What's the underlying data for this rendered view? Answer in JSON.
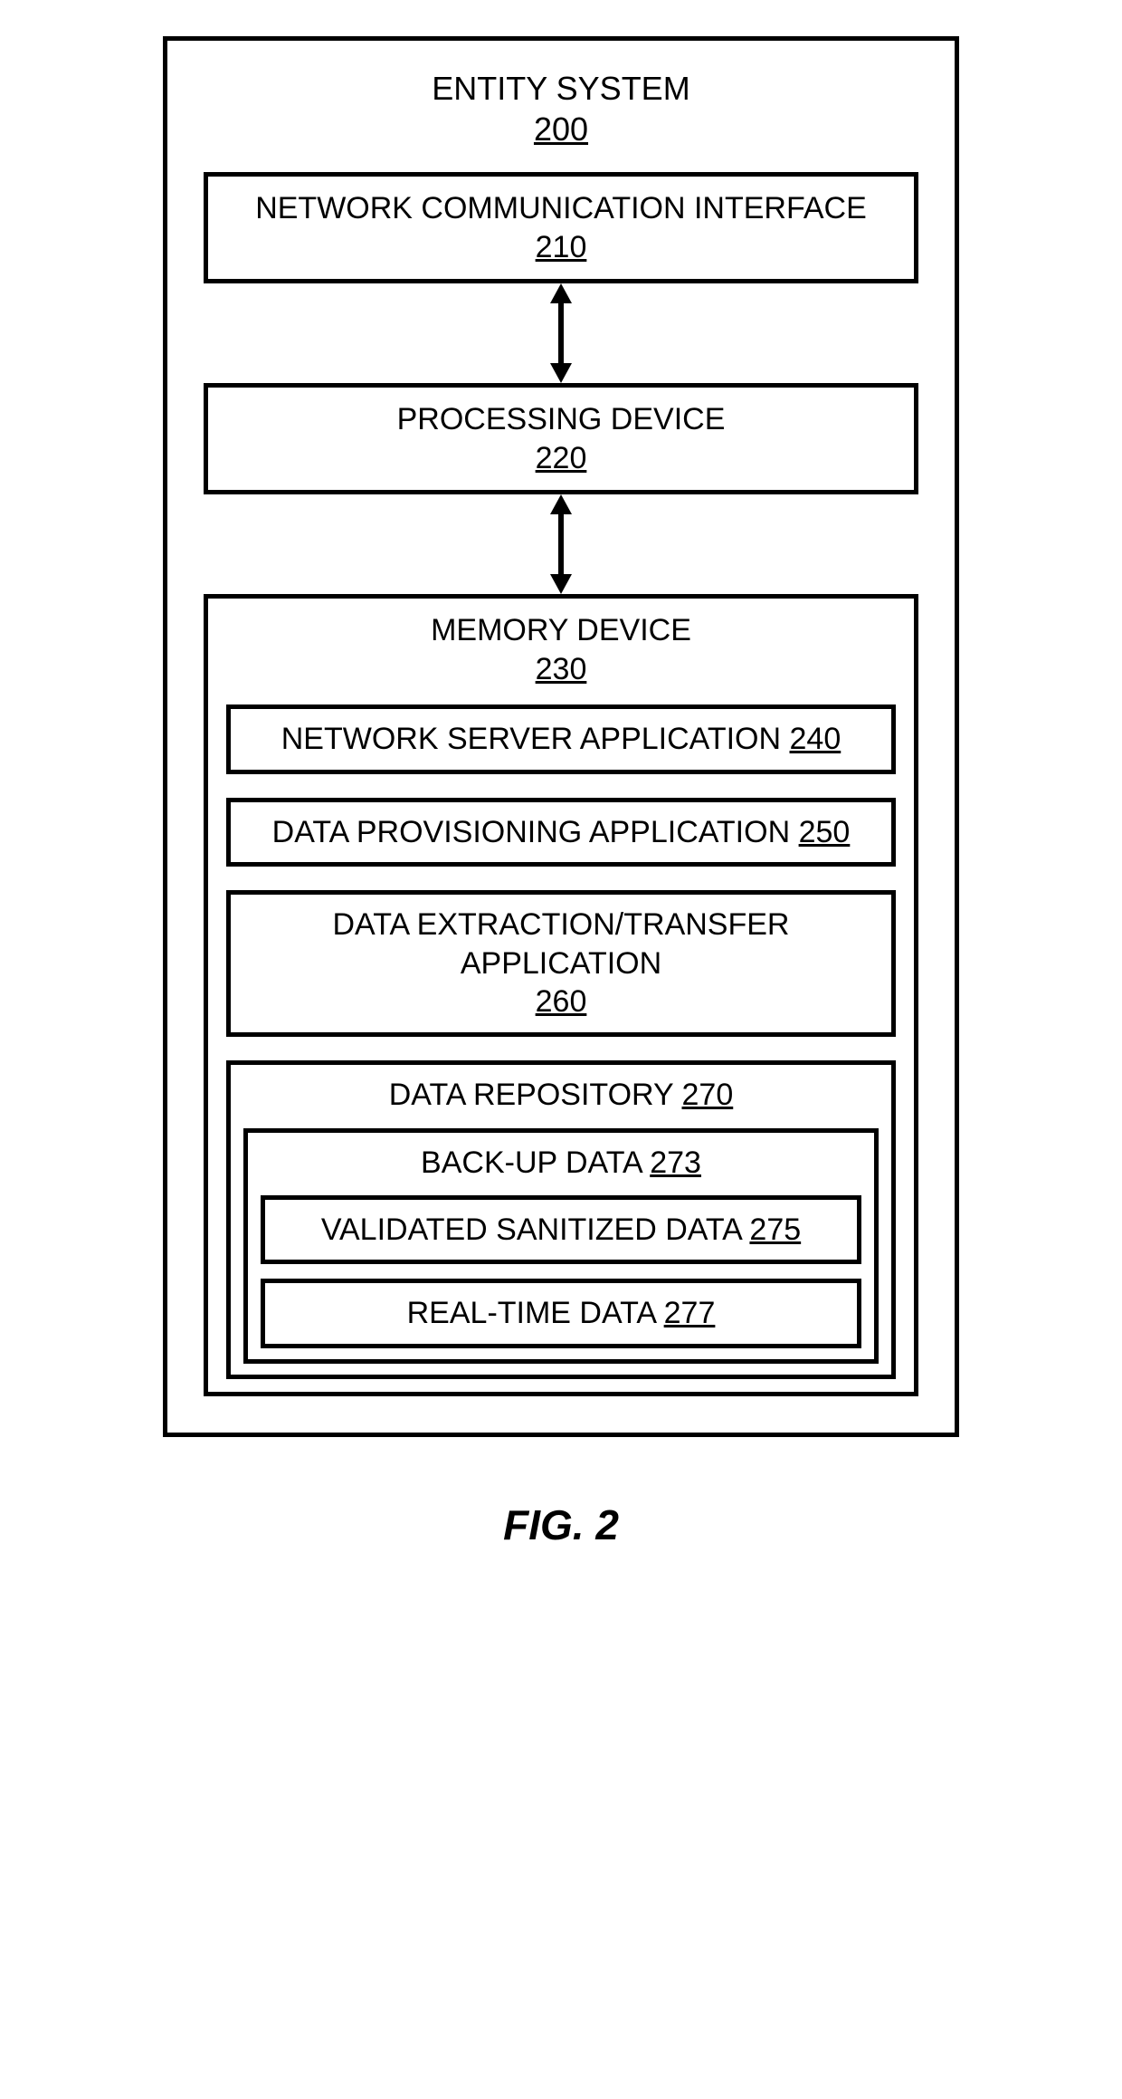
{
  "entity": {
    "label": "ENTITY SYSTEM",
    "ref": "200"
  },
  "nci": {
    "label": "NETWORK COMMUNICATION INTERFACE",
    "ref": "210"
  },
  "proc": {
    "label": "PROCESSING DEVICE",
    "ref": "220"
  },
  "mem": {
    "label": "MEMORY DEVICE",
    "ref": "230"
  },
  "nsa": {
    "label": "NETWORK SERVER APPLICATION",
    "ref": "240"
  },
  "dpa": {
    "label": "DATA PROVISIONING APPLICATION",
    "ref": "250"
  },
  "deta": {
    "label": "DATA EXTRACTION/TRANSFER APPLICATION",
    "ref": "260"
  },
  "repo": {
    "label": "DATA REPOSITORY",
    "ref": "270"
  },
  "backup": {
    "label": "BACK-UP DATA",
    "ref": "273"
  },
  "vsd": {
    "label": "VALIDATED SANITIZED DATA",
    "ref": "275"
  },
  "rtd": {
    "label": "REAL-TIME DATA",
    "ref": "277"
  },
  "figure": "FIG. 2"
}
